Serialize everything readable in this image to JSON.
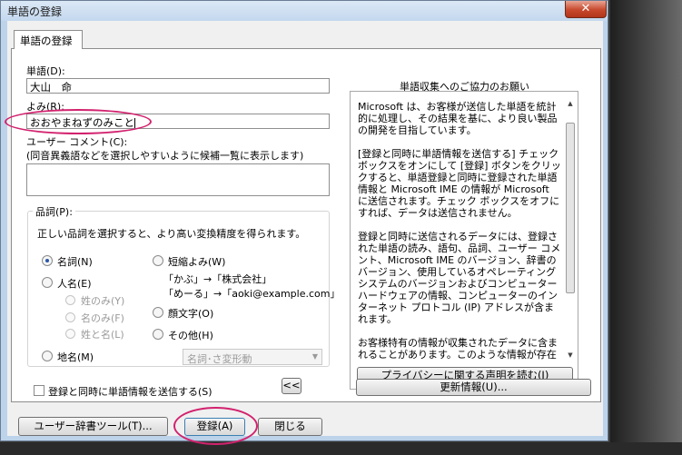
{
  "window": {
    "title": "単語の登録",
    "close_glyph": "✕"
  },
  "tab": {
    "label": "単語の登録"
  },
  "word": {
    "label": "単語(D):",
    "value": "大山　命"
  },
  "reading": {
    "label": "よみ(R):",
    "value": "おおやまねずのみこと"
  },
  "comment": {
    "label": "ユーザー コメント(C):",
    "hint": "(同音異義語などを選択しやすいように候補一覧に表示します)",
    "value": ""
  },
  "pos": {
    "legend": "品詞(P):",
    "description": "正しい品詞を選択すると、より高い変換精度を得られます。",
    "noun": "名詞(N)",
    "person": "人名(E)",
    "surname_only": "姓のみ(Y)",
    "given_only": "名のみ(F)",
    "surname_given": "姓と名(L)",
    "place": "地名(M)",
    "short_reading": "短縮よみ(W)",
    "short_example1": "「かぶ」→「株式会社」",
    "short_example2": "「めーる」→「aoki@example.com」",
    "emoticon": "顔文字(O)",
    "other": "その他(H)",
    "other_select": "名詞･さ変形動",
    "selected": "noun"
  },
  "send_checkbox": {
    "label": "登録と同時に単語情報を送信する(S)",
    "checked": false
  },
  "collapse_button": "<<",
  "info": {
    "title": "単語収集へのご協力のお願い",
    "paragraphs": [
      "Microsoft は、お客様が送信した単語を統計的に処理し、その結果を基に、より良い製品の開発を目指しています。",
      "[登録と同時に単語情報を送信する] チェック ボックスをオンにして [登録] ボタンをクリックすると、単語登録と同時に登録された単語情報と Microsoft IME の情報が Microsoft に送信されます。チェック ボックスをオフにすれば、データは送信されません。",
      "登録と同時に送信されるデータには、登録された単語の読み、語句、品詞、ユーザー コメント、Microsoft IME のバージョン、辞書のバージョン、使用しているオペレーティング システムのバージョンおよびコンピューター ハードウェアの情報、コンピューターのインターネット プロトコル (IP) アドレスが含まれます。",
      "お客様特有の情報が収集されたデータに含まれることがあります。このような情報が存在する場合でも、Microsoft では、お客様を"
    ],
    "privacy_button": "プライバシーに関する声明を読む(I)"
  },
  "update_button": "更新情報(U)...",
  "bottom": {
    "dict_tool": "ユーザー辞書ツール(T)...",
    "register": "登録(A)",
    "close": "閉じる"
  },
  "colors": {
    "highlight_ellipse": "#d2226e",
    "titlebar": "#c4d8ee",
    "close_button": "#c7482c"
  }
}
